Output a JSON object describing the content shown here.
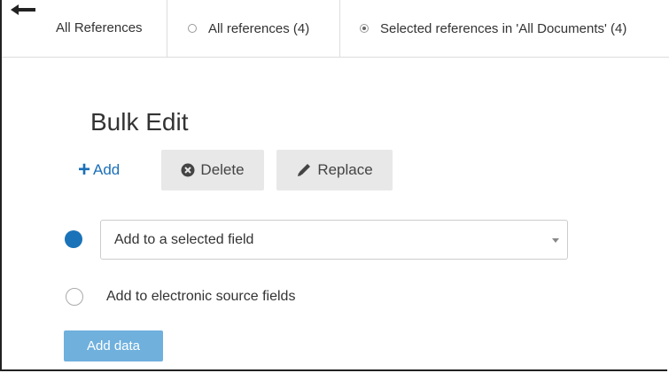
{
  "topbar": {
    "back_icon": "arrow-left-icon",
    "tab_all_label": "All References",
    "option_all_refs": "All references (4)",
    "option_selected_refs": "Selected references in 'All Documents' (4)",
    "selected_option": "Selected references in 'All Documents' (4)"
  },
  "main": {
    "title": "Bulk Edit",
    "actions": {
      "add_label": "Add",
      "add_icon": "plus-icon",
      "delete_label": "Delete",
      "delete_icon": "x-circle-icon",
      "replace_label": "Replace",
      "replace_icon": "pencil-icon"
    },
    "mode_selected_field": {
      "selected": true,
      "dropdown_value": "Add to a selected field"
    },
    "mode_electronic": {
      "selected": false,
      "label": "Add to electronic source fields"
    },
    "submit_label": "Add data"
  },
  "colors": {
    "accent": "#1a73b8",
    "button_gray": "#e8e8e8",
    "submit_bg": "#6fb0dd"
  }
}
